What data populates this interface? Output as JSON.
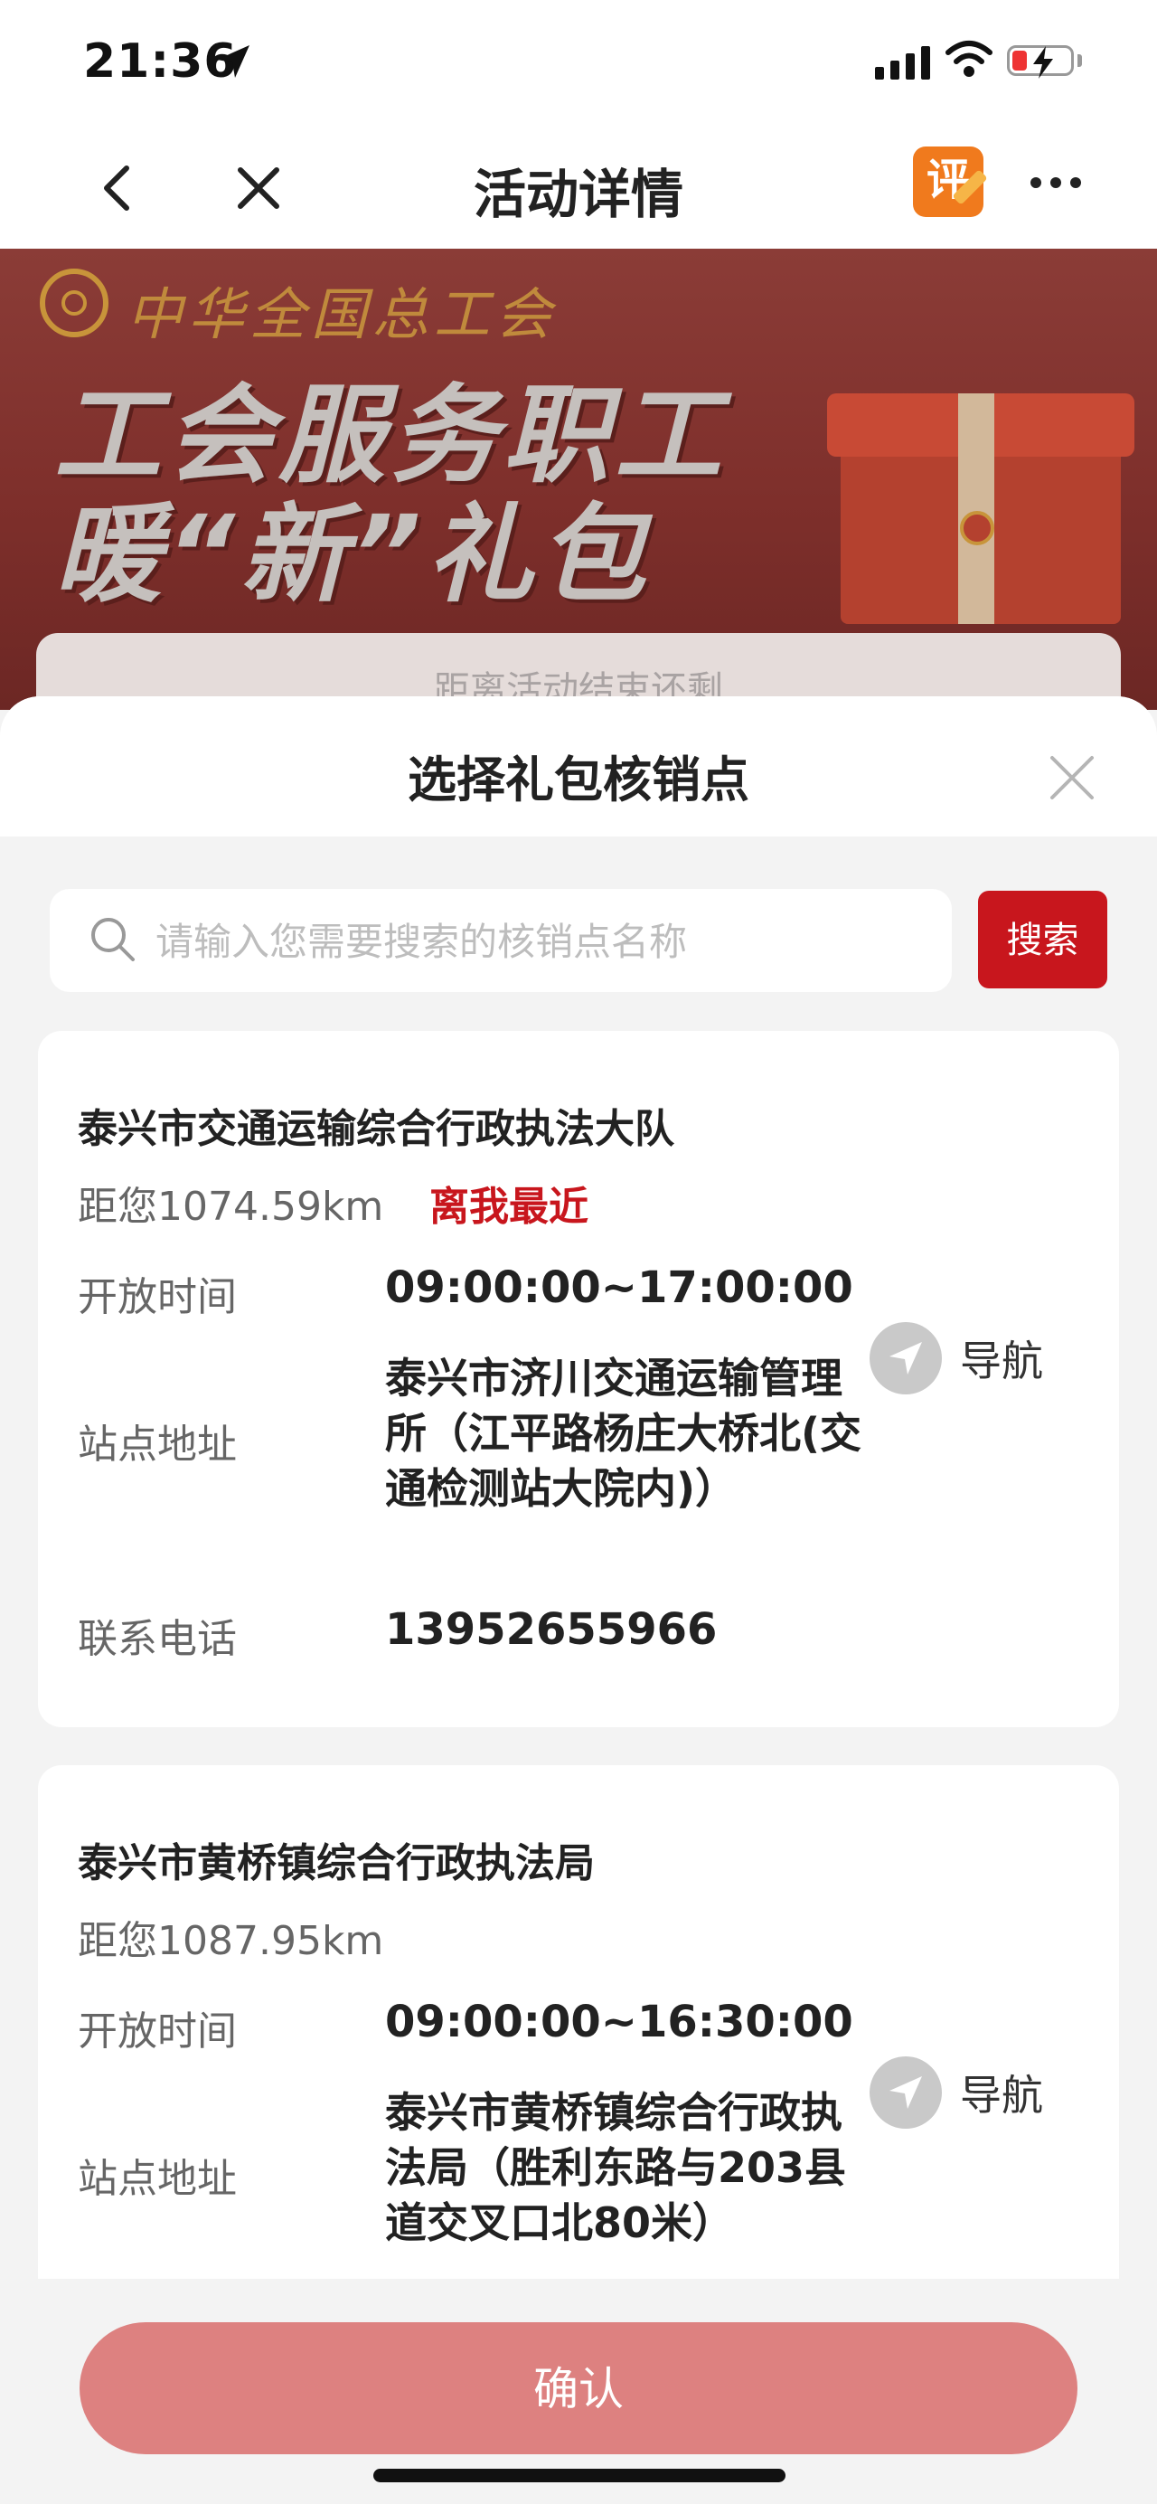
{
  "status_bar": {
    "time": "21:36"
  },
  "nav": {
    "title": "活动详情",
    "review_badge": "评"
  },
  "banner": {
    "org_name": "中华全国总工会",
    "headline_line1": "工会服务职工",
    "headline_line2": "暖“新”礼包",
    "card_text": "距离活动结束还剩"
  },
  "sheet": {
    "title": "选择礼包核销点",
    "search": {
      "placeholder": "请输入您需要搜索的核销点名称",
      "value": "",
      "button_label": "搜索"
    },
    "labels": {
      "open_hours": "开放时间",
      "address": "站点地址",
      "phone": "联系电话",
      "navigate": "导航"
    },
    "points": [
      {
        "name": "泰兴市交通运输综合行政执法大队",
        "distance": "距您1074.59km",
        "nearest_tag": "离我最近",
        "hours": "09:00:00~17:00:00",
        "address": "泰兴市济川交通运输管理所（江平路杨庄大桥北(交通检测站大院内)）",
        "phone": "13952655966"
      },
      {
        "name": "泰兴市黄桥镇综合行政执法局",
        "distance": "距您1087.95km",
        "hours": "09:00:00~16:30:00",
        "address": "泰兴市黄桥镇综合行政执法局（胜利东路与203县道交叉口北80米）"
      }
    ]
  },
  "confirm_label": "确认",
  "colors": {
    "brand_red": "#c8161d",
    "confirm_disabled": "#dd8180",
    "review_orange": "#f07a1d"
  }
}
